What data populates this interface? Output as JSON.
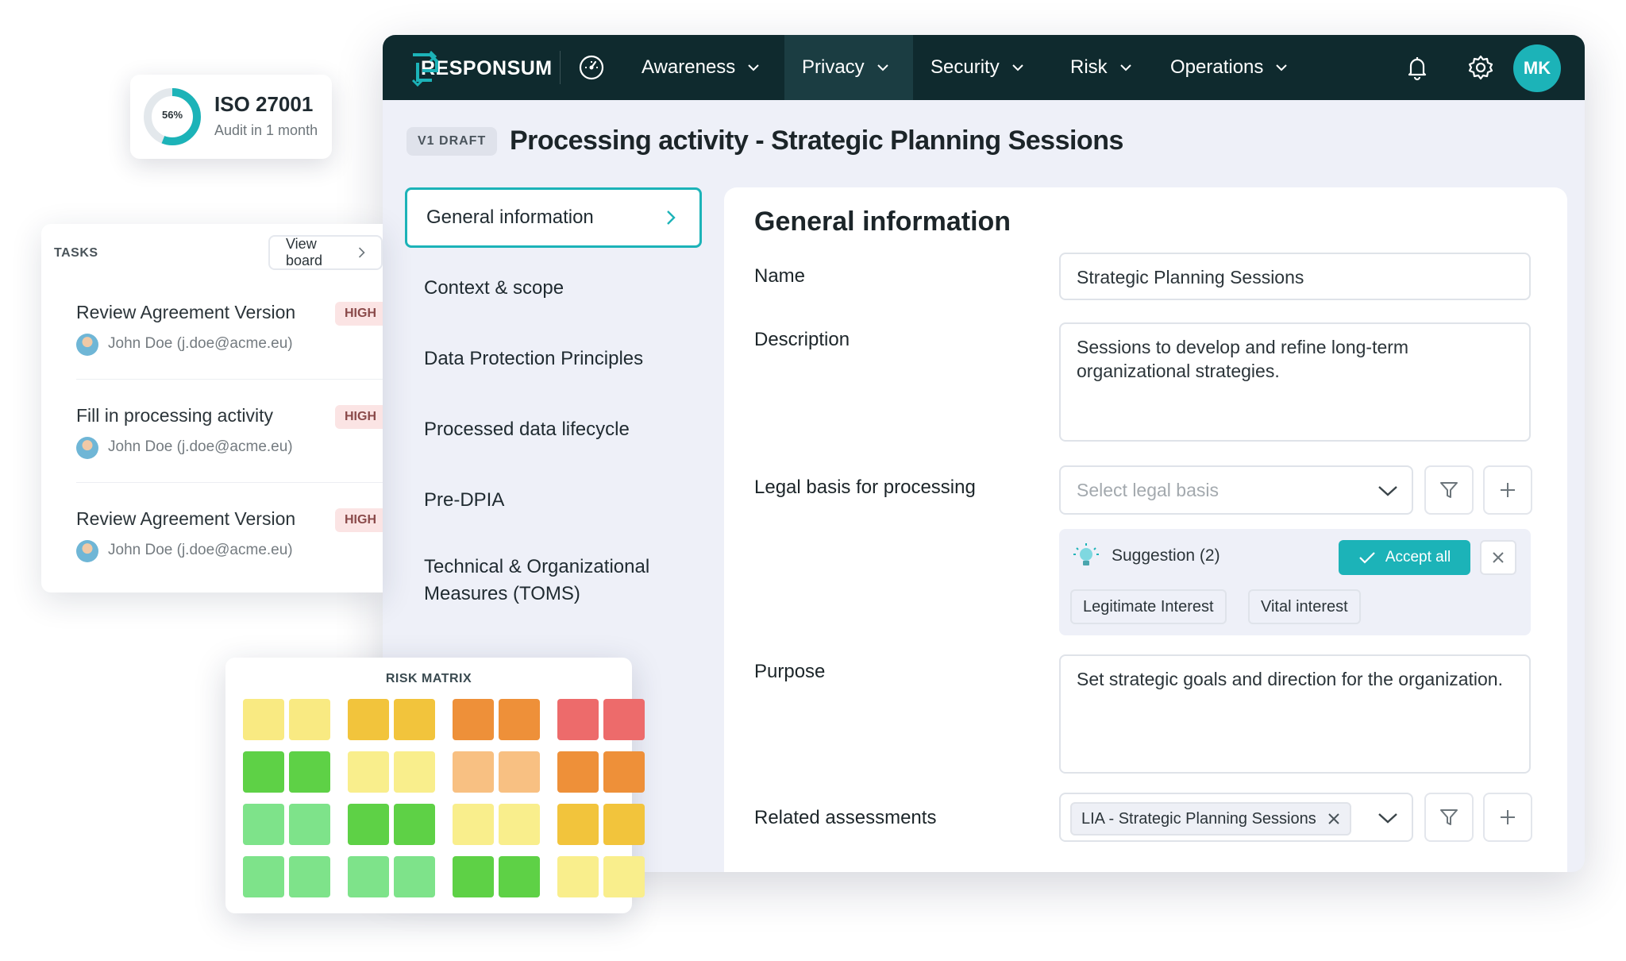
{
  "header": {
    "brand": "RESPONSUM",
    "nav": [
      {
        "label": "Awareness",
        "active": false
      },
      {
        "label": "Privacy",
        "active": true
      },
      {
        "label": "Security",
        "active": false
      },
      {
        "label": "Risk",
        "active": false
      },
      {
        "label": "Operations",
        "active": false
      }
    ],
    "icons": [
      "dashboard-gauge-icon",
      "bell-icon",
      "gear-icon"
    ],
    "avatar_initials": "MK"
  },
  "page": {
    "version_badge": "V1 DRAFT",
    "title": "Processing activity - Strategic Planning Sessions"
  },
  "sidebar": {
    "items": [
      {
        "label": "General information",
        "active": true
      },
      {
        "label": "Context & scope"
      },
      {
        "label": "Data Protection Principles"
      },
      {
        "label": "Processed data lifecycle"
      },
      {
        "label": "Pre-DPIA"
      },
      {
        "label": "Technical & Organizational Measures (TOMS)"
      }
    ]
  },
  "form": {
    "heading": "General information",
    "name_label": "Name",
    "name_value": "Strategic Planning Sessions",
    "description_label": "Description",
    "description_value": "Sessions to develop and refine long-term organizational strategies.",
    "legal_basis_label": "Legal basis for processing",
    "legal_basis_placeholder": "Select legal basis",
    "suggestion_label": "Suggestion (2)",
    "accept_all_label": "Accept all",
    "suggestions": [
      "Legitimate Interest",
      "Vital interest"
    ],
    "purpose_label": "Purpose",
    "purpose_value": "Set strategic goals and direction for the organization.",
    "related_label": "Related assessments",
    "related_tag": "LIA - Strategic Planning Sessions"
  },
  "iso_card": {
    "percent_label": "56%",
    "percent_value": 0.56,
    "title": "ISO 27001",
    "subtitle": "Audit in 1 month"
  },
  "tasks_card": {
    "title": "TASKS",
    "view_board": "View board",
    "tasks": [
      {
        "title": "Review Agreement Version",
        "user": "John Doe (j.doe@acme.eu)",
        "priority": "HIGH"
      },
      {
        "title": "Fill in processing activity",
        "user": "John Doe (j.doe@acme.eu)",
        "priority": "HIGH"
      },
      {
        "title": "Review Agreement Version",
        "user": "John Doe (j.doe@acme.eu)",
        "priority": "HIGH"
      }
    ]
  },
  "risk_matrix": {
    "title": "RISK MATRIX",
    "rows": [
      [
        "#f9ea82",
        "#f9ea82",
        "#f2c43c",
        "#f2c43c",
        "#ee9039",
        "#ee9039",
        "#ed6b6b",
        "#ed6b6b"
      ],
      [
        "#5ed146",
        "#5ed146",
        "#f9ee8c",
        "#f9ee8c",
        "#f8c082",
        "#f8c082",
        "#ee9039",
        "#ee9039"
      ],
      [
        "#7ee38a",
        "#7ee38a",
        "#5ed146",
        "#5ed146",
        "#f9ee8c",
        "#f9ee8c",
        "#f2c43c",
        "#f2c43c"
      ],
      [
        "#7ee38a",
        "#7ee38a",
        "#7ee38a",
        "#7ee38a",
        "#5ed146",
        "#5ed146",
        "#f9ee8c",
        "#f9ee8c"
      ]
    ]
  },
  "colors": {
    "topbar": "#0f2a2e",
    "accent": "#1cb3b8",
    "page_bg": "#eef0f8"
  }
}
